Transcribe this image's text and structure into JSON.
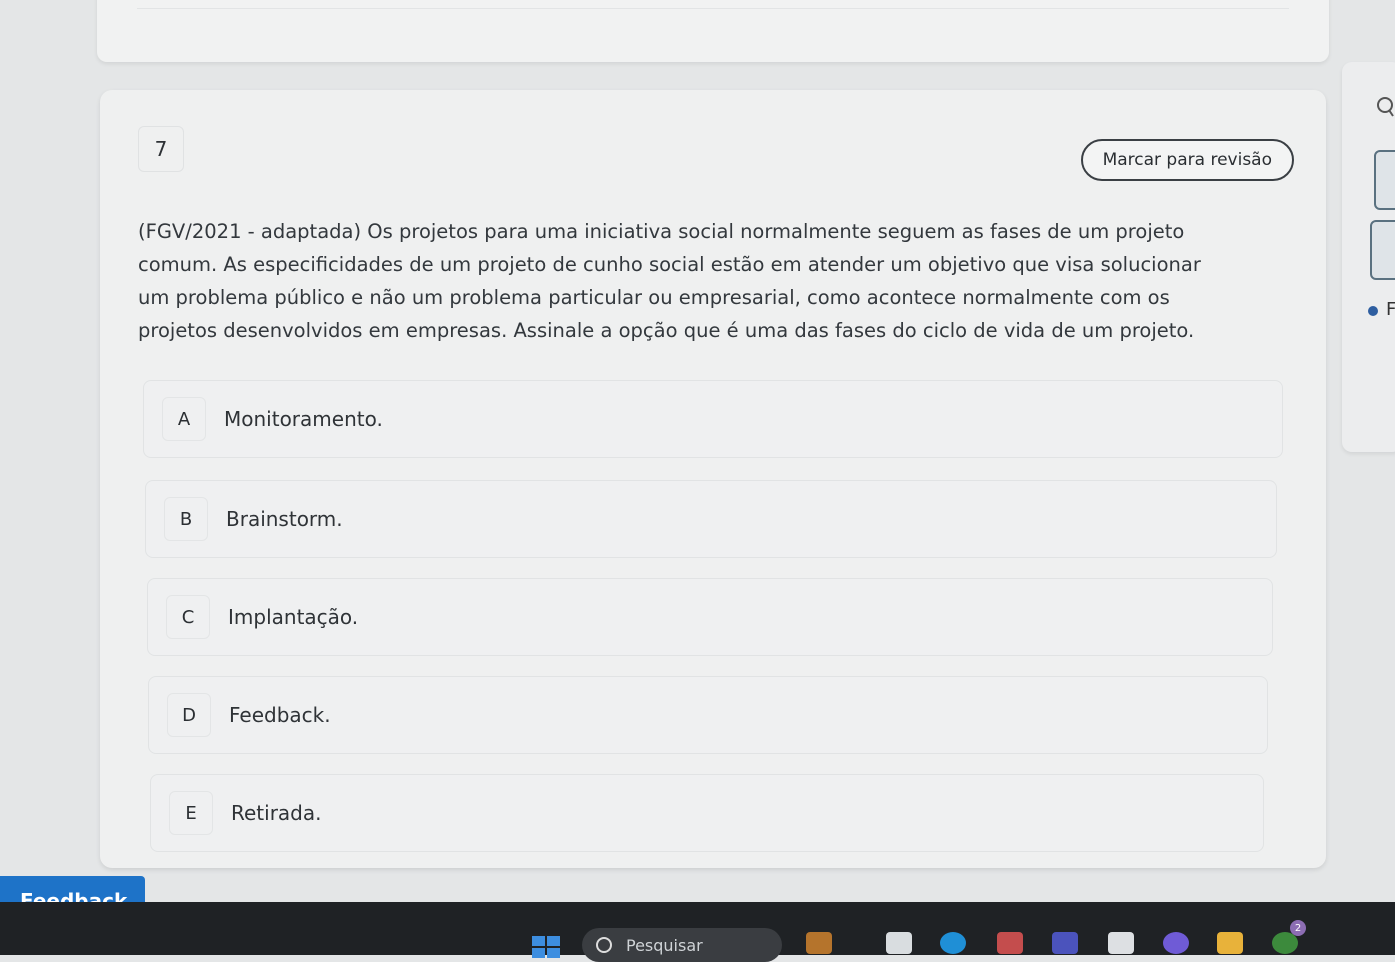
{
  "question": {
    "number": "7",
    "review_button_label": "Marcar para revisão",
    "statement_lines": [
      "(FGV/2021 - adaptada) Os projetos para uma iniciativa social normalmente seguem as fases de um projeto",
      "comum. As especificidades de um projeto de cunho social estão em atender um objetivo que visa solucionar",
      "um problema público e não um problema particular ou empresarial, como acontece normalmente com os",
      "projetos desenvolvidos em empresas. Assinale a opção que é uma das fases do ciclo de vida de um projeto."
    ],
    "options": [
      {
        "letter": "A",
        "text": "Monitoramento."
      },
      {
        "letter": "B",
        "text": "Brainstorm."
      },
      {
        "letter": "C",
        "text": "Implantação."
      },
      {
        "letter": "D",
        "text": "Feedback."
      },
      {
        "letter": "E",
        "text": "Retirada."
      }
    ]
  },
  "side_panel": {
    "search_icon": "search-icon",
    "partial_text": "F"
  },
  "feedback_tab": {
    "label": "Feedback",
    "color": "#1e73c8"
  },
  "taskbar": {
    "search_placeholder": "Pesquisar",
    "badge_count": "2"
  }
}
